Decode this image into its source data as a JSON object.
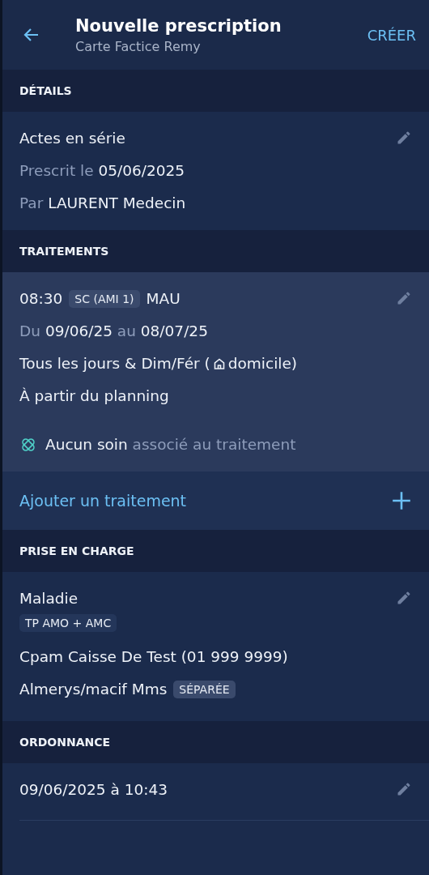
{
  "header": {
    "title": "Nouvelle prescription",
    "subtitle": "Carte Factice Remy",
    "action": "CRÉER"
  },
  "details": {
    "heading": "DÉTAILS",
    "lines": [
      [
        {
          "text": "Actes en série",
          "muted": false
        }
      ],
      [
        {
          "text": "Prescrit le",
          "muted": true
        },
        {
          "text": "05/06/2025",
          "muted": false
        }
      ],
      [
        {
          "text": "Par",
          "muted": true
        },
        {
          "text": "LAURENT Medecin",
          "muted": false
        }
      ]
    ]
  },
  "treatments": {
    "heading": "TRAITEMENTS",
    "items": [
      {
        "time": "08:30",
        "tag": "SC (AMI 1)",
        "code": "MAU",
        "period": [
          {
            "text": "Du",
            "muted": true
          },
          {
            "text": "09/06/25",
            "muted": false
          },
          {
            "text": "au",
            "muted": true
          },
          {
            "text": "08/07/25",
            "muted": false
          }
        ],
        "schedule_before": "Tous les jours & Dim/Fér (",
        "schedule_after": "domicile)",
        "start": "À partir du planning",
        "care": [
          {
            "text": "Aucun soin",
            "muted": false
          },
          {
            "text": "associé au traitement",
            "muted": true
          }
        ]
      }
    ],
    "add_label": "Ajouter un traitement"
  },
  "coverage": {
    "heading": "PRISE EN CHARGE",
    "type": "Maladie",
    "tag": "TP AMO + AMC",
    "fund": "Cpam Caisse De Test (01 999 9999)",
    "insurer": "Almerys/macif Mms",
    "insurer_tag": "SÉPARÉE"
  },
  "prescription": {
    "heading": "ORDONNANCE",
    "date": "09/06/2025 à 10:43"
  }
}
